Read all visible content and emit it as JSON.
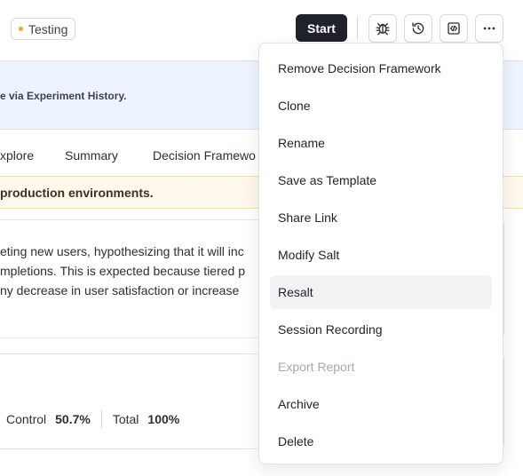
{
  "header": {
    "status_label": "Testing",
    "start_label": "Start",
    "icons": [
      "bug-icon",
      "history-icon",
      "code-icon",
      "more-icon"
    ]
  },
  "info_banner": {
    "text": "e via Experiment History."
  },
  "tabs": [
    {
      "label": "xplore"
    },
    {
      "label": "Summary"
    },
    {
      "label": "Decision Framewo"
    }
  ],
  "warning_banner": {
    "text": "production environments."
  },
  "hypothesis": {
    "lines": [
      "eting new users, hypothesizing that it will inc",
      "mpletions. This is expected because tiered p",
      "ny decrease in user satisfaction or increase"
    ]
  },
  "traffic": {
    "control_label": "Control",
    "control_value": "50.7%",
    "total_label": "Total",
    "total_value": "100%"
  },
  "menu": {
    "items": [
      {
        "label": "Remove Decision Framework",
        "state": "normal"
      },
      {
        "label": "Clone",
        "state": "normal"
      },
      {
        "label": "Rename",
        "state": "normal"
      },
      {
        "label": "Save as Template",
        "state": "normal"
      },
      {
        "label": "Share Link",
        "state": "normal"
      },
      {
        "label": "Modify Salt",
        "state": "normal"
      },
      {
        "label": "Resalt",
        "state": "hover"
      },
      {
        "label": "Session Recording",
        "state": "normal"
      },
      {
        "label": "Export Report",
        "state": "disabled"
      },
      {
        "label": "Archive",
        "state": "normal"
      },
      {
        "label": "Delete",
        "state": "normal"
      }
    ]
  },
  "colors": {
    "status_dot": "#f5a623",
    "start_button": "#1f2329",
    "info_banner": "#eef4ff",
    "warning_banner": "#fff8ec",
    "menu_hover": "#f1f2f4",
    "disabled_text": "#a3a8b0"
  }
}
